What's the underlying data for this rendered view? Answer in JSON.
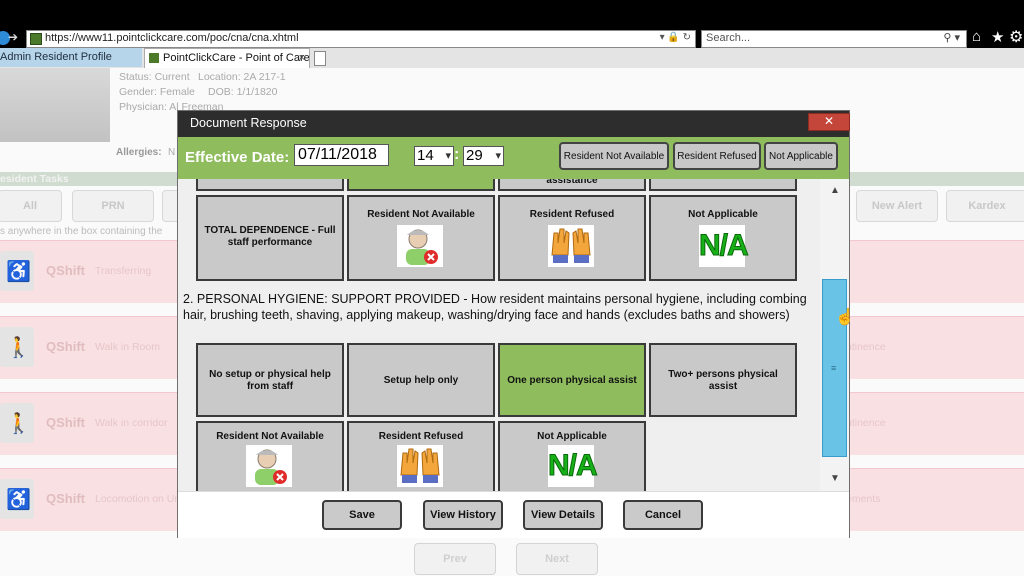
{
  "browser": {
    "url": "https://www11.pointclickcare.com/poc/cna/cna.xhtml",
    "search_placeholder": "Search...",
    "tabs": [
      {
        "label": "Admin Resident Profile"
      },
      {
        "label": "PointClickCare - Point of Care..."
      }
    ]
  },
  "background": {
    "status": "Status: Current",
    "location": "Location: 2A 217-1",
    "gender": "Gender: Female",
    "dob": "DOB: 1/1/1820",
    "physician": "Physician: Al Freeman",
    "allergies_label": "Allergies:",
    "allergies_value": "N",
    "tasks_title": "esident Tasks",
    "filter_buttons": [
      "All",
      "PRN",
      "",
      "New Alert",
      "Kardex"
    ],
    "hint": "s anywhere in the box containing the",
    "tasks": [
      {
        "shift": "QShift",
        "name": "Transferring",
        "right": ""
      },
      {
        "shift": "QShift",
        "name": "Walk in Room",
        "right": "ntinence"
      },
      {
        "shift": "QShift",
        "name": "Walk in corridor",
        "right": "ntinence"
      },
      {
        "shift": "QShift",
        "name": "Locomotion on Uni",
        "right": "ements"
      }
    ],
    "prev_label": "Prev",
    "next_label": "Next"
  },
  "dialog": {
    "title": "Document Response",
    "close_symbol": "✕",
    "effective_date_label": "Effective Date:",
    "date_value": "07/11/2018",
    "hour": "14",
    "minute": "29",
    "header_buttons": [
      "Resident Not Available",
      "Resident Refused",
      "Not Applicable"
    ],
    "section1": {
      "partial_text": "assistance",
      "cards": [
        {
          "label": "TOTAL DEPENDENCE - Full staff performance",
          "icon": ""
        },
        {
          "label": "Resident Not Available",
          "icon": "resident-unavailable-icon"
        },
        {
          "label": "Resident Refused",
          "icon": "hands-refused-icon"
        },
        {
          "label": "Not Applicable",
          "icon": "na-icon",
          "na_text": "N/A"
        }
      ]
    },
    "question2": "2.   PERSONAL HYGIENE: SUPPORT PROVIDED - How resident maintains personal hygiene, including combing hair, brushing teeth, shaving, applying makeup, washing/drying face and hands (excludes baths and showers)",
    "section2": {
      "cards": [
        {
          "label": "No setup or physical help from staff",
          "selected": false
        },
        {
          "label": "Setup help only",
          "selected": false
        },
        {
          "label": "One person physical assist",
          "selected": true
        },
        {
          "label": "Two+ persons physical assist",
          "selected": false
        },
        {
          "label": "Resident Not Available",
          "icon": "resident-unavailable-icon"
        },
        {
          "label": "Resident Refused",
          "icon": "hands-refused-icon"
        },
        {
          "label": "Not Applicable",
          "icon": "na-icon",
          "na_text": "N/A"
        }
      ]
    },
    "footer_buttons": [
      "Save",
      "View History",
      "View Details",
      "Cancel"
    ]
  },
  "colors": {
    "header_green": "#8fbd5e",
    "selected_green": "#8fbd5e",
    "scroll_thumb": "#69c3e6",
    "close_red": "#c4453a"
  }
}
